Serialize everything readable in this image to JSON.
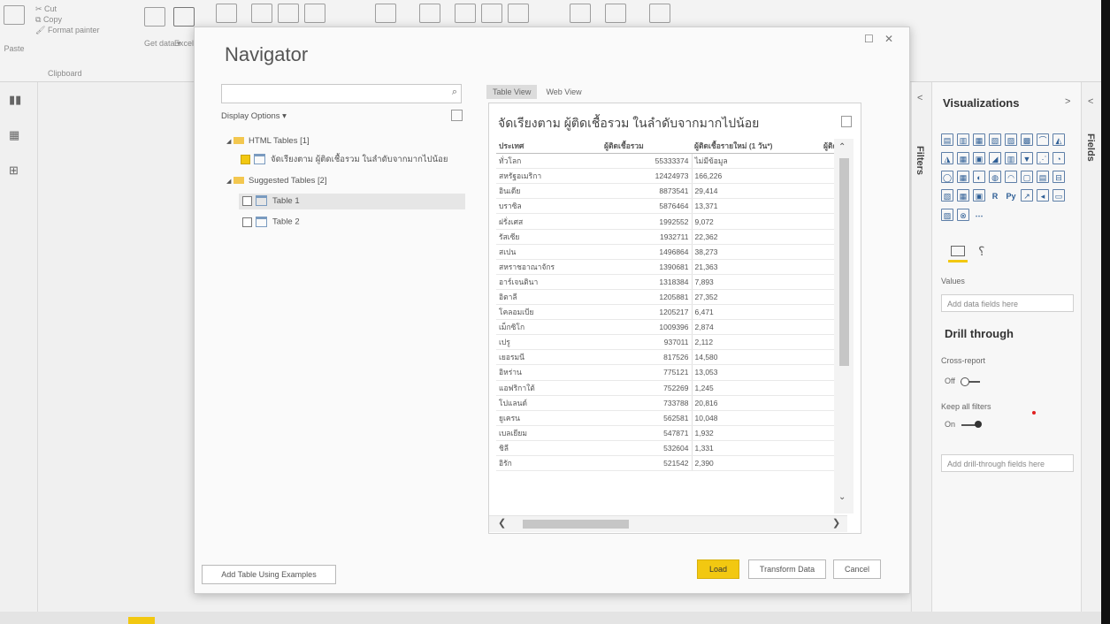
{
  "ribbon": {
    "paste": "Paste",
    "cut": "Cut",
    "copy": "Copy",
    "format_painter": "Format painter",
    "clipboard_group": "Clipboard",
    "get_data": "Get data ▾",
    "excel": "Excel"
  },
  "navigator": {
    "title": "Navigator",
    "display_options": "Display Options ▾",
    "tree": {
      "html_tables": "HTML Tables [1]",
      "html_table_1": "จัดเรียงตาม ผู้ติดเชื้อรวม ในลำดับจากมากไปน้อย",
      "suggested_tables": "Suggested Tables [2]",
      "table1": "Table 1",
      "table2": "Table 2"
    },
    "tabs": [
      "Table View",
      "Web View"
    ],
    "preview_title": "จัดเรียงตาม ผู้ติดเชื้อรวม ในลำดับจากมากไปน้อย",
    "columns": [
      "ประเทศ",
      "ผู้ติดเชื้อรวม",
      "ผู้ติดเชื้อรายใหม่ (1 วัน*)",
      "ผู้ติดเชื้อ"
    ],
    "rows": [
      [
        "ทั่วโลก",
        "55333374",
        "ไม่มีข้อมูล"
      ],
      [
        "สหรัฐอเมริกา",
        "12424973",
        "166,226"
      ],
      [
        "อินเดีย",
        "8873541",
        "29,414"
      ],
      [
        "บราซิล",
        "5876464",
        "13,371"
      ],
      [
        "ฝรั่งเศส",
        "1992552",
        "9,072"
      ],
      [
        "รัสเซีย",
        "1932711",
        "22,362"
      ],
      [
        "สเปน",
        "1496864",
        "38,273"
      ],
      [
        "สหราชอาณาจักร",
        "1390681",
        "21,363"
      ],
      [
        "อาร์เจนตินา",
        "1318384",
        "7,893"
      ],
      [
        "อิตาลี",
        "1205881",
        "27,352"
      ],
      [
        "โคลอมเบีย",
        "1205217",
        "6,471"
      ],
      [
        "เม็กซิโก",
        "1009396",
        "2,874"
      ],
      [
        "เปรู",
        "937011",
        "2,112"
      ],
      [
        "เยอรมนี",
        "817526",
        "14,580"
      ],
      [
        "อิหร่าน",
        "775121",
        "13,053"
      ],
      [
        "แอฟริกาใต้",
        "752269",
        "1,245"
      ],
      [
        "โปแลนด์",
        "733788",
        "20,816"
      ],
      [
        "ยูเครน",
        "562581",
        "10,048"
      ],
      [
        "เบลเยียม",
        "547871",
        "1,932"
      ],
      [
        "ชิลี",
        "532604",
        "1,331"
      ],
      [
        "อิรัก",
        "521542",
        "2,390"
      ]
    ],
    "add_table_button": "Add Table Using Examples",
    "load_button": "Load",
    "transform_button": "Transform Data",
    "cancel_button": "Cancel"
  },
  "panes": {
    "filters": "Filters",
    "visualizations": "Visualizations",
    "fields": "Fields",
    "values_label": "Values",
    "values_placeholder": "Add data fields here",
    "drill_through": "Drill through",
    "cross_report": "Cross-report",
    "cross_report_state": "Off",
    "keep_all_filters": "Keep all filters",
    "keep_all_filters_state": "On",
    "drill_placeholder": "Add drill-through fields here"
  },
  "colors": {
    "accent": "#f2c811",
    "visual_icon": "#2f5f96"
  }
}
